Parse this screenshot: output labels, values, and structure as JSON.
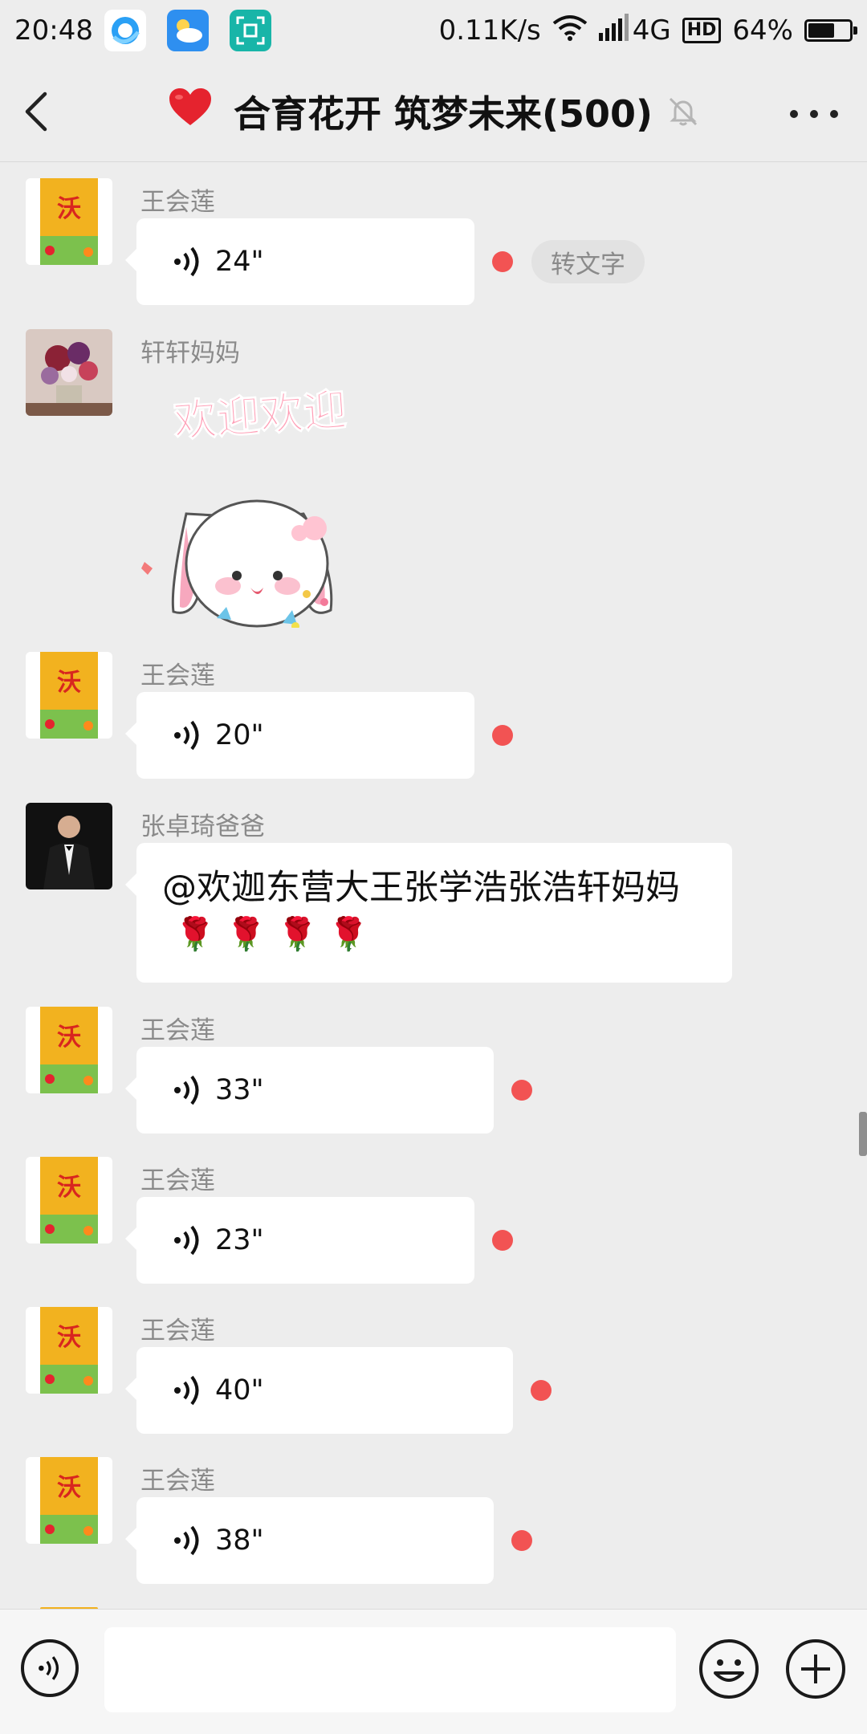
{
  "status_bar": {
    "time": "20:48",
    "network_speed": "0.11K/s",
    "network_type": "4G",
    "hd_badge": "HD",
    "battery_percent": "64%",
    "battery_level": 0.64
  },
  "header": {
    "title": "合育花开 筑梦未来(500)",
    "title_emoji": "❤️",
    "back_icon": "chevron-left-icon",
    "mute_icon": "bell-off-icon",
    "more_icon": "more-dots-icon"
  },
  "messages": [
    {
      "sender": "王会莲",
      "type": "voice",
      "duration": "24\"",
      "unread": true,
      "transcribe_label": "转文字"
    },
    {
      "sender": "轩轩妈妈",
      "type": "sticker",
      "sticker_text": "欢迎欢迎"
    },
    {
      "sender": "王会莲",
      "type": "voice",
      "duration": "20\"",
      "unread": true
    },
    {
      "sender": "张卓琦爸爸",
      "type": "text",
      "text": "@欢迦东营大王张学浩张浩轩妈妈",
      "emoji_line": "🌹🌹🌹🌹"
    },
    {
      "sender": "王会莲",
      "type": "voice",
      "duration": "33\"",
      "unread": true
    },
    {
      "sender": "王会莲",
      "type": "voice",
      "duration": "23\"",
      "unread": true
    },
    {
      "sender": "王会莲",
      "type": "voice",
      "duration": "40\"",
      "unread": true
    },
    {
      "sender": "王会莲",
      "type": "voice",
      "duration": "38\"",
      "unread": true
    }
  ],
  "input_bar": {
    "value": "",
    "voice_icon": "voice-toggle-icon",
    "emoji_icon": "smiley-icon",
    "plus_icon": "plus-icon"
  },
  "colors": {
    "background": "#ededed",
    "bubble": "#ffffff",
    "unread_dot": "#f25353",
    "sender_name": "#8a8a8a"
  }
}
